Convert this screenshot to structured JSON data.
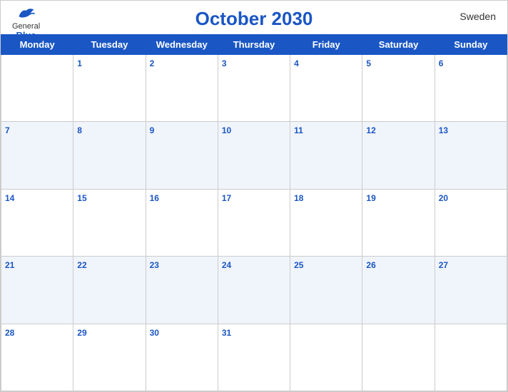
{
  "header": {
    "title": "October 2030",
    "country": "Sweden",
    "logo_general": "General",
    "logo_blue": "Blue"
  },
  "days_of_week": [
    "Monday",
    "Tuesday",
    "Wednesday",
    "Thursday",
    "Friday",
    "Saturday",
    "Sunday"
  ],
  "weeks": [
    [
      null,
      1,
      2,
      3,
      4,
      5,
      6
    ],
    [
      7,
      8,
      9,
      10,
      11,
      12,
      13
    ],
    [
      14,
      15,
      16,
      17,
      18,
      19,
      20
    ],
    [
      21,
      22,
      23,
      24,
      25,
      26,
      27
    ],
    [
      28,
      29,
      30,
      31,
      null,
      null,
      null
    ]
  ]
}
